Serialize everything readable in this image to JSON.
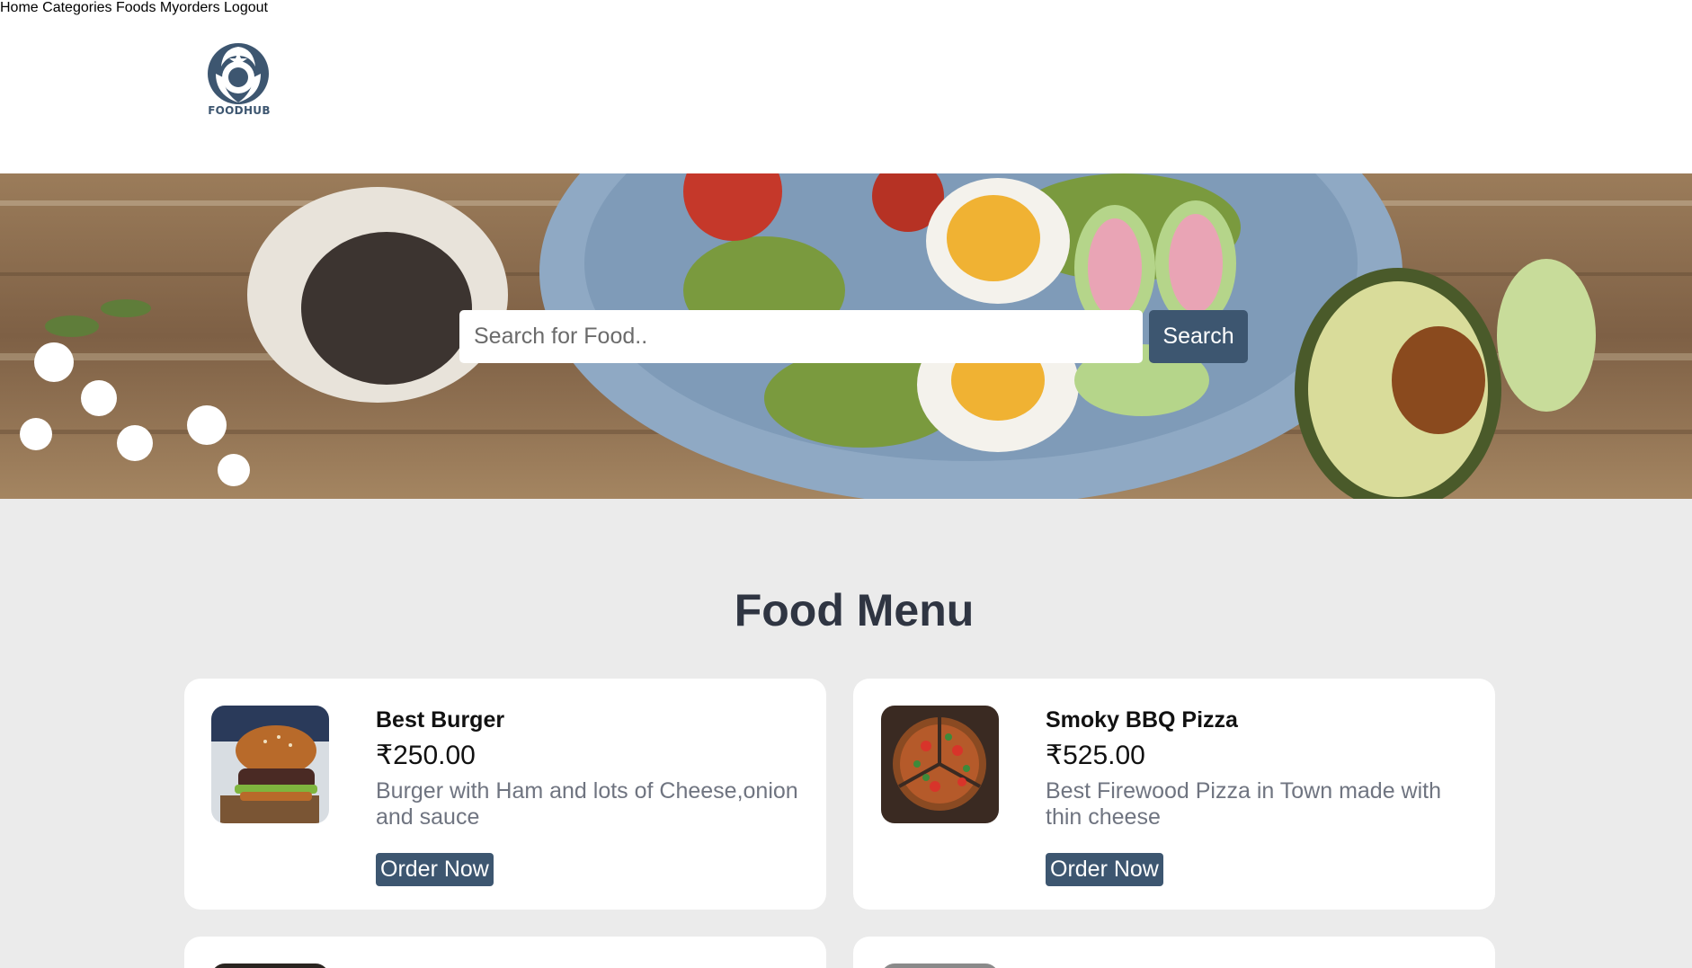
{
  "brand": {
    "logo_text": "FOODHUB",
    "color": "#3d5670"
  },
  "nav": {
    "items": [
      {
        "label": "Home"
      },
      {
        "label": "Categories"
      },
      {
        "label": "Foods"
      },
      {
        "label": "Myorders"
      },
      {
        "label": "Logout"
      }
    ]
  },
  "search": {
    "placeholder": "Search for Food..",
    "value": "",
    "button_label": "Search"
  },
  "menu": {
    "title": "Food Menu",
    "items": [
      {
        "name": "Best Burger",
        "price": "₹250.00",
        "description": "Burger with Ham and lots of Cheese,onion and sauce",
        "button_label": "Order Now",
        "image": "burger-photo"
      },
      {
        "name": "Smoky BBQ Pizza",
        "price": "₹525.00",
        "description": "Best Firewood Pizza in Town made with thin cheese",
        "button_label": "Order Now",
        "image": "pizza-photo"
      }
    ]
  },
  "colors": {
    "accent": "#3d5670",
    "page_bg": "#ebebeb",
    "card_bg": "#ffffff",
    "title": "#2f3542",
    "description": "#6f7480"
  }
}
